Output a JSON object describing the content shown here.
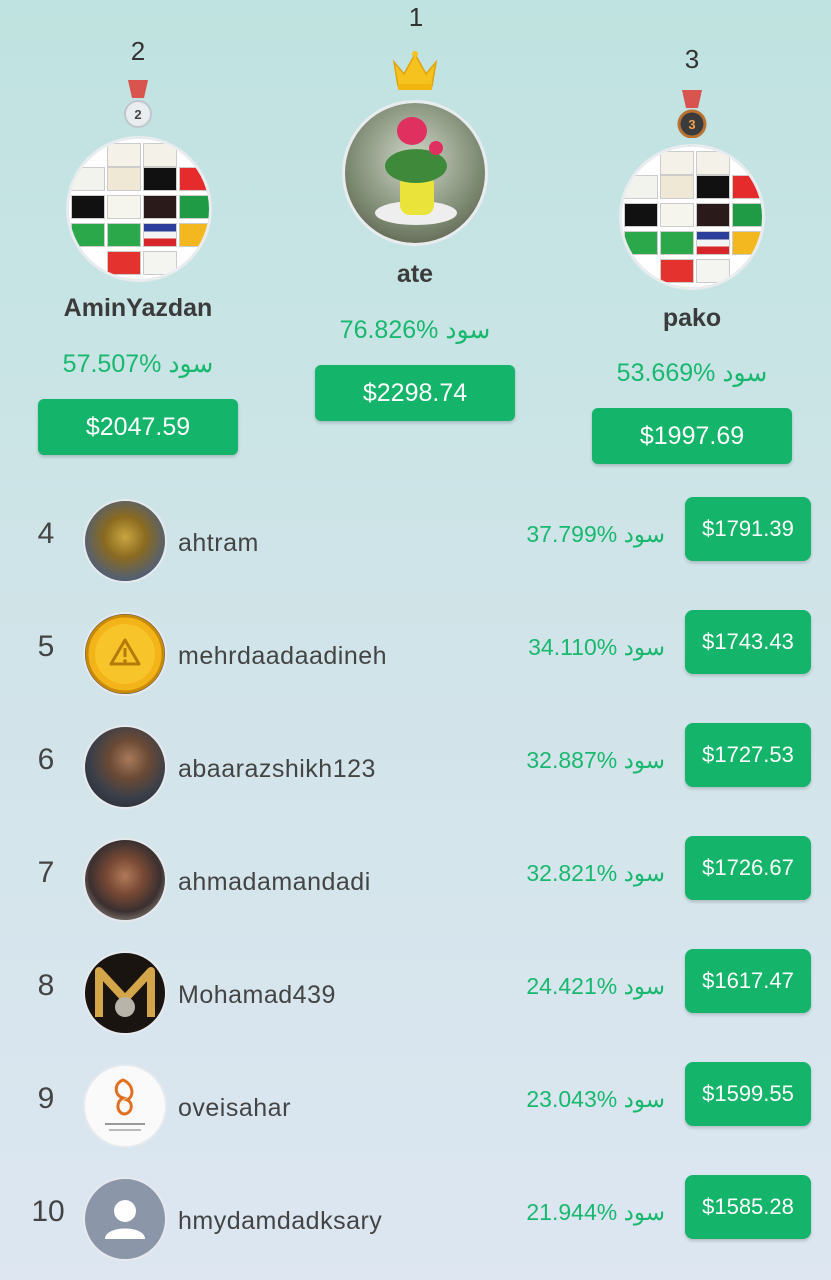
{
  "podium": [
    {
      "rank": "2",
      "badge": "2",
      "username": "AminYazdan",
      "profit": "57.507% سود",
      "amount": "$2047.59",
      "icon": "silver-medal-icon"
    },
    {
      "rank": "1",
      "username": "ate",
      "profit": "76.826% سود",
      "amount": "$2298.74",
      "icon": "crown-icon"
    },
    {
      "rank": "3",
      "badge": "3",
      "username": "pako",
      "profit": "53.669% سود",
      "amount": "$1997.69",
      "icon": "bronze-medal-icon"
    }
  ],
  "list": [
    {
      "rank": "4",
      "username": "ahtram",
      "profit": "37.799% سود",
      "amount": "$1791.39"
    },
    {
      "rank": "5",
      "username": "mehrdaadaadineh",
      "profit": "34.110% سود",
      "amount": "$1743.43"
    },
    {
      "rank": "6",
      "username": "abaarazshikh123",
      "profit": "32.887% سود",
      "amount": "$1727.53"
    },
    {
      "rank": "7",
      "username": "ahmadamandadi",
      "profit": "32.821% سود",
      "amount": "$1726.67"
    },
    {
      "rank": "8",
      "username": "Mohamad439",
      "profit": "24.421% سود",
      "amount": "$1617.47"
    },
    {
      "rank": "9",
      "username": "oveisahar",
      "profit": "23.043% سود",
      "amount": "$1599.55"
    },
    {
      "rank": "10",
      "username": "hmydamdadksary",
      "profit": "21.944% سود",
      "amount": "$1585.28"
    }
  ],
  "colors": {
    "accent": "#14b46a",
    "profit_text": "#19b86f"
  }
}
